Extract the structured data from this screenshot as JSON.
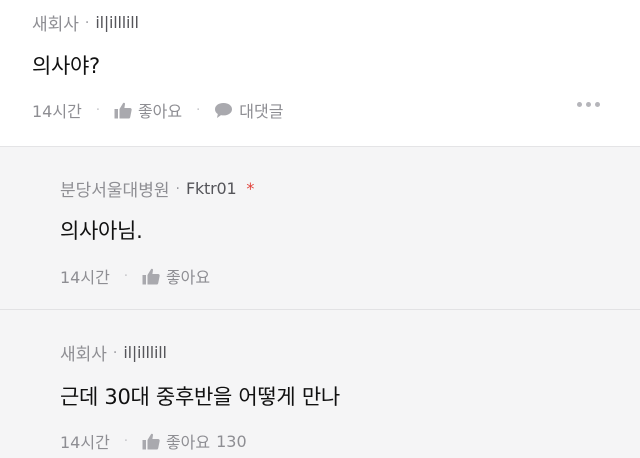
{
  "comments": [
    {
      "board": "새회사",
      "nickname": "il|illlill",
      "text": "의사야?",
      "time": "14시간",
      "like_label": "좋아요",
      "reply_label": "대댓글"
    },
    {
      "board": "분당서울대병원",
      "nickname": "Fktr01",
      "author_mark": "*",
      "text": "의사아님.",
      "time": "14시간",
      "like_label": "좋아요"
    },
    {
      "board": "새회사",
      "nickname": "il|illlill",
      "text": "근데 30대 중후반을 어떻게 만나",
      "time": "14시간",
      "like_label": "좋아요",
      "like_count": "130"
    }
  ],
  "separator": "·",
  "icons": [
    "thumbs-up-icon",
    "speech-bubble-icon",
    "more-dots-icon"
  ],
  "colors": {
    "author_mark": "#e0413a",
    "reply_bg": "#f5f5f6",
    "meta_text": "#8e8e93"
  }
}
